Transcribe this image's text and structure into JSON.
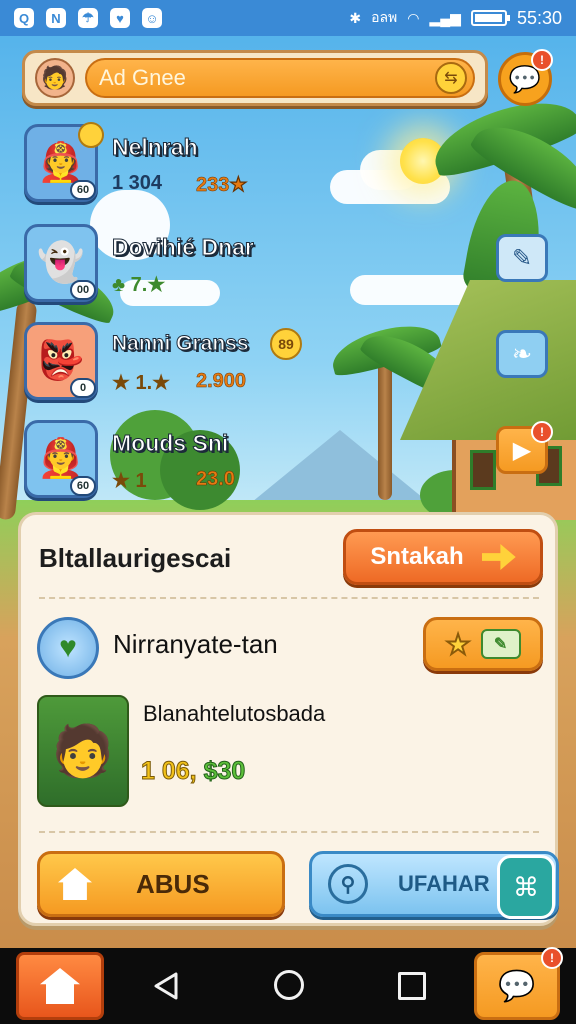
{
  "status_bar": {
    "time": "55:30",
    "signal_text": "อลพ",
    "apps": [
      "Q",
      "N",
      "☂",
      "♥",
      "☺"
    ],
    "battery_level": 0.95
  },
  "top_bar": {
    "search_placeholder": "Ad Gnee",
    "search_icon": "arrow-swap-icon",
    "chat_badge": "!"
  },
  "leaderboard": [
    {
      "name": "Nelnrah",
      "stat1": "1 304",
      "stat2": "233★",
      "level": "60",
      "icon": "🧑‍🚒",
      "bg": "#6fb0e6",
      "coin": ""
    },
    {
      "name": "Dovihié Dnar",
      "stat1": "♣ 7.★",
      "stat2": "",
      "level": "00",
      "icon": "👻",
      "bg": "#7fc3ef",
      "coin": ""
    },
    {
      "name": "Nanni Granss",
      "stat1": "★ 1.★",
      "stat2": "2.900",
      "level": "0",
      "icon": "👺",
      "bg": "#f7a07a",
      "coin": "89"
    },
    {
      "name": "Mouds Sni",
      "stat1": "★ 1",
      "stat2": "23.0",
      "level": "60",
      "icon": "👨‍🚒",
      "bg": "#7fc3ef",
      "coin": ""
    }
  ],
  "side_buttons": [
    {
      "name": "edit-icon",
      "glyph": "✎",
      "badge": ""
    },
    {
      "name": "feather-icon",
      "glyph": "❧",
      "badge": ""
    },
    {
      "name": "play-icon",
      "glyph": "▶",
      "badge": "!"
    }
  ],
  "panel": {
    "title": "Bltallaurigescai",
    "stalk_button": "Sntakah",
    "mission_name": "Nirranyate-tan",
    "hero_name": "Blanahtelutosbada",
    "hero_value_a": "1 06, ",
    "hero_value_b": "$30",
    "abus_button": "ABUS",
    "upgrade_button": "UFAHAR"
  },
  "nav": {
    "chat_badge": "!"
  },
  "colors": {
    "accent_orange": "#f59a22",
    "panel_bg": "#fbf3e6",
    "sky": "#4fb0ea"
  }
}
